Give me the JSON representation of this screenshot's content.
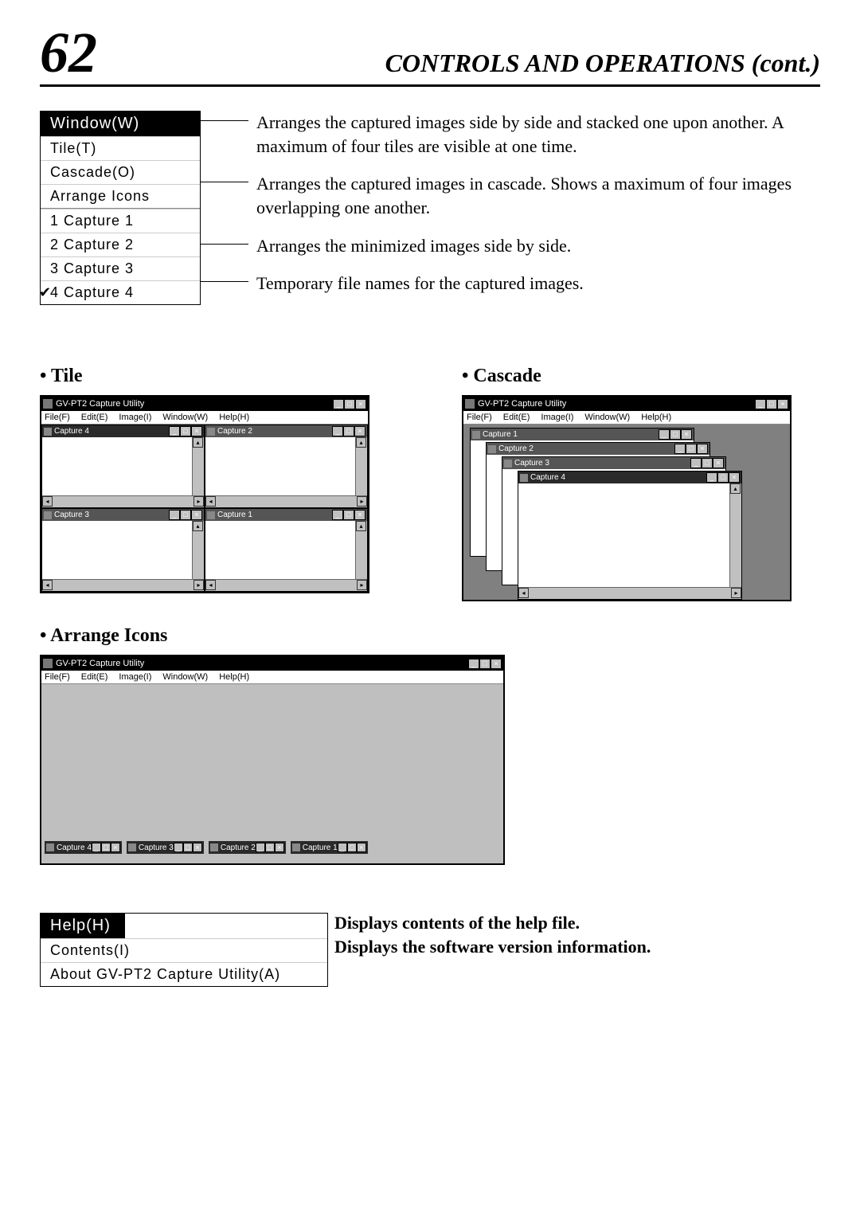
{
  "page": {
    "number": "62",
    "title": "CONTROLS AND OPERATIONS (cont.)"
  },
  "windowMenu": {
    "title": "Window(W)",
    "items": [
      {
        "label": "Tile(T)"
      },
      {
        "label": "Cascade(O)"
      },
      {
        "label": "Arrange Icons"
      },
      {
        "label": "1  Capture 1"
      },
      {
        "label": "2  Capture 2"
      },
      {
        "label": "3  Capture 3"
      },
      {
        "label": "4  Capture 4",
        "checked": true
      }
    ],
    "descriptions": {
      "tile": "Arranges the captured images side by side and stacked one upon another. A maximum of four tiles are visible at one time.",
      "cascade": "Arranges the captured images in cascade. Shows a maximum of four images overlapping one another.",
      "arrange": "Arranges the minimized images side by side.",
      "captures": "Temporary file names for the captured images."
    }
  },
  "subheadings": {
    "tile": "Tile",
    "cascade": "Cascade",
    "arrange": "Arrange Icons"
  },
  "app": {
    "title": "GV-PT2 Capture Utility",
    "menubar": {
      "file": "File(F)",
      "edit": "Edit(E)",
      "image": "Image(I)",
      "window": "Window(W)",
      "help": "Help(H)"
    },
    "captures": {
      "c1": "Capture 1",
      "c2": "Capture 2",
      "c3": "Capture 3",
      "c4": "Capture 4"
    }
  },
  "helpMenu": {
    "title": "Help(H)",
    "items": {
      "contents": "Contents(I)",
      "about": "About GV-PT2 Capture Utility(A)"
    },
    "descriptions": {
      "contents": "Displays contents of the help file.",
      "about": "Displays the software version information."
    }
  }
}
